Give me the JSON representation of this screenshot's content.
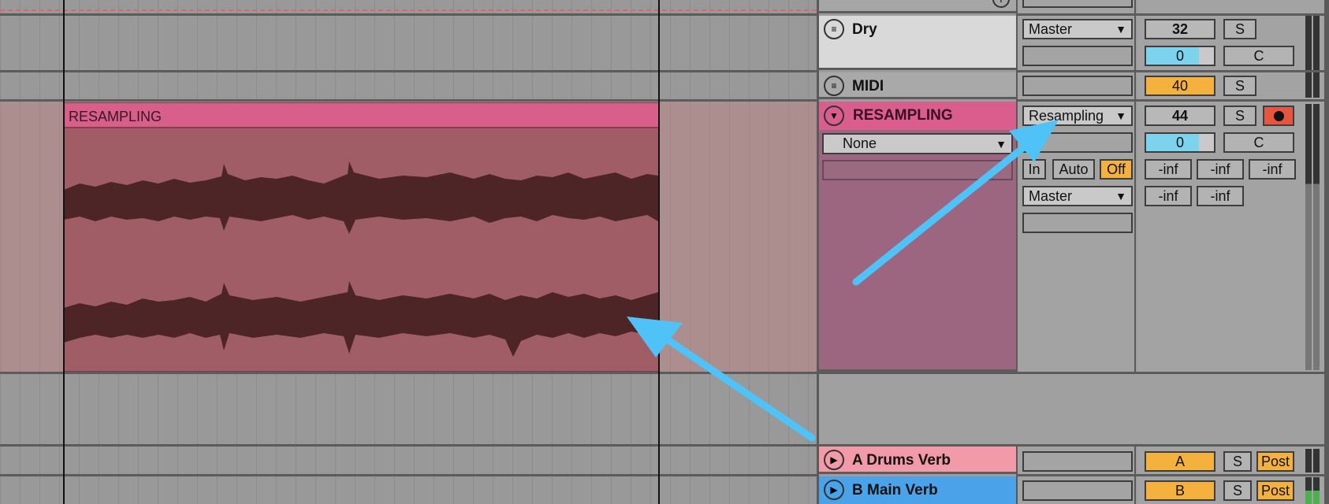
{
  "tracks": {
    "dry": {
      "name": "Dry",
      "output": "Master",
      "volume": "32",
      "solo": "S",
      "pan": "0",
      "center": "C"
    },
    "midi": {
      "name": "MIDI",
      "volume": "40",
      "solo": "S"
    },
    "resampling": {
      "name": "RESAMPLING",
      "clip_label": "RESAMPLING",
      "input_type": "Resampling",
      "input_channel": "None",
      "volume": "44",
      "solo": "S",
      "pan": "0",
      "center": "C",
      "monitor": [
        "In",
        "Auto",
        "Off"
      ],
      "output": "Master",
      "peak_values": [
        "-inf",
        "-inf",
        "-inf",
        "-inf",
        "-inf"
      ]
    },
    "return_a": {
      "name": "A Drums Verb",
      "send": "A",
      "solo": "S",
      "mode": "Post"
    },
    "return_b": {
      "name": "B Main Verb",
      "send": "B",
      "solo": "S",
      "mode": "Post"
    }
  },
  "colors": {
    "resampling_clip": "#a05d66",
    "resampling_header": "#da5e8d",
    "return_a": "#f29aa7",
    "return_b": "#4aa3e8",
    "annotation_arrow": "#4fc3f7",
    "orange_value": "#f4b13d",
    "blue_value": "#7dd3ee"
  }
}
